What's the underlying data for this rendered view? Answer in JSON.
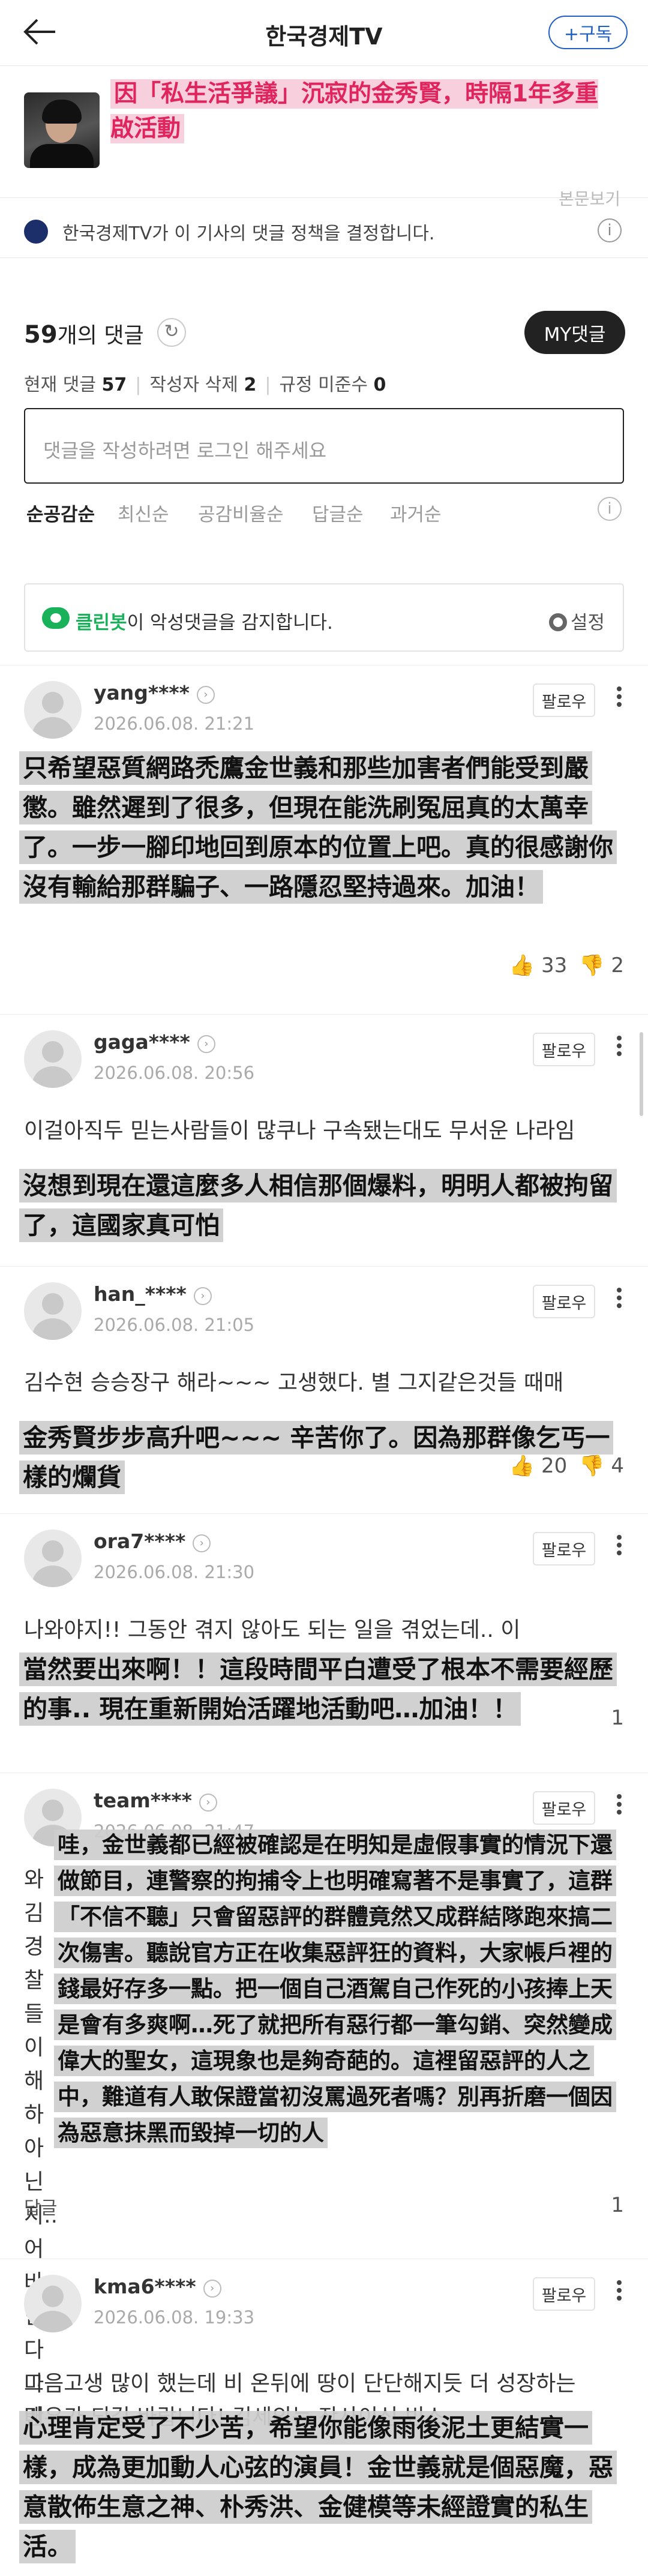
{
  "header": {
    "title": "한국경제TV",
    "subscribe_label": "+구독"
  },
  "article": {
    "title": "因「私生活爭議」沉寂的金秀賢，時隔1年多重啟活動",
    "hidden_label": "본문보기"
  },
  "notice": {
    "text": "한국경제TV가 이 기사의 댓글 정책을 결정합니다.",
    "info_icon": "i"
  },
  "summary": {
    "count": "59",
    "count_suffix": "개의 댓글",
    "my_button": "MY댓글",
    "current_label": "현재 댓글",
    "current_value": "57",
    "deleted_label": "작성자 삭제",
    "deleted_value": "2",
    "violation_label": "규정 미준수",
    "violation_value": "0",
    "input_placeholder": "댓글을 작성하려면 로그인 해주세요"
  },
  "sort_tabs": [
    "순공감순",
    "최신순",
    "공감비율순",
    "답글순",
    "과거순"
  ],
  "cleanbot": {
    "name": "클린봇",
    "message": "이 악성댓글을 감지합니다.",
    "settings_label": "설정"
  },
  "follow_label": "팔로우",
  "comments": [
    {
      "user": "yang****",
      "date": "2026.06.08. 21:21",
      "original": "",
      "translation": "只希望惡質網路禿鷹金世義和那些加害者們能受到嚴懲。雖然遲到了很多，但現在能洗刷冤屈真的太萬幸了。一步一腳印地回到原本的位置上吧。真的很感謝你沒有輸給那群騙子、一路隱忍堅持過來。加油！",
      "likes": "33",
      "dislikes": "2"
    },
    {
      "user": "gaga****",
      "date": "2026.06.08. 20:56",
      "original": "이걸아직두 믿는사람들이 많쿠나 구속됐는대도 무서운 나라임",
      "translation": "沒想到現在還這麼多人相信那個爆料，明明人都被拘留了，這國家真可怕",
      "likes": "",
      "dislikes": ""
    },
    {
      "user": "han_****",
      "date": "2026.06.08. 21:05",
      "original": "김수현 승승장구 해라~~~ 고생했다. 별 그지같은것들 때매",
      "translation": "金秀賢步步高升吧~~~ 辛苦你了。因為那群像乞丐一樣的爛貨",
      "likes": "20",
      "dislikes": "4"
    },
    {
      "user": "ora7****",
      "date": "2026.06.08. 21:30",
      "original": "나와야지!! 그동안 겪지 않아도 되는 일을 겪었는데.. 이",
      "translation": "當然要出來啊！！這段時間平白遭受了根本不需要經歷的事.. 現在重新開始活躍地活動吧…加油！！",
      "likes": "",
      "dislikes": "1"
    },
    {
      "user": "team****",
      "date": "2026.06.08. 21:47",
      "original": "와 김 경찰 들이 해하 아닌 지.. 어바 한다 그만",
      "translation": "哇，金世義都已經被確認是在明知是虛假事實的情況下還做節目，連警察的拘捕令上也明確寫著不是事實了，這群「不信不聽」只會留惡評的群體竟然又成群結隊跑來搞二次傷害。聽說官方正在收集惡評狂的資料，大家帳戶裡的錢最好存多一點。把一個自己酒駕自己作死的小孩捧上天是會有多爽啊…死了就把所有惡行都一筆勾銷、突然變成偉大的聖女，這現象也是夠奇葩的。這裡留惡評的人之中，難道有人敢保證當初沒罵過死者嗎？別再折磨一個因為惡意抹黑而毀掉一切的人",
      "reply_label": "답글",
      "likes": "",
      "dislikes": "1"
    },
    {
      "user": "kma6****",
      "date": "2026.06.08. 19:33",
      "original": "마음고생 많이 했는데 비 온뒤에 땅이 단단해지듯 더 성장하는 배우가 되길 바랍니다! 김세의는 잔사이신 빈스",
      "translation": "心理肯定受了不少苦，希望你能像雨後泥土更結實一樣，成為更加動人心弦的演員！金世義就是個惡魔，惡意散佈生意之神、朴秀洪、金健模等未經證實的私生活。",
      "likes": "",
      "dislikes": ""
    }
  ]
}
